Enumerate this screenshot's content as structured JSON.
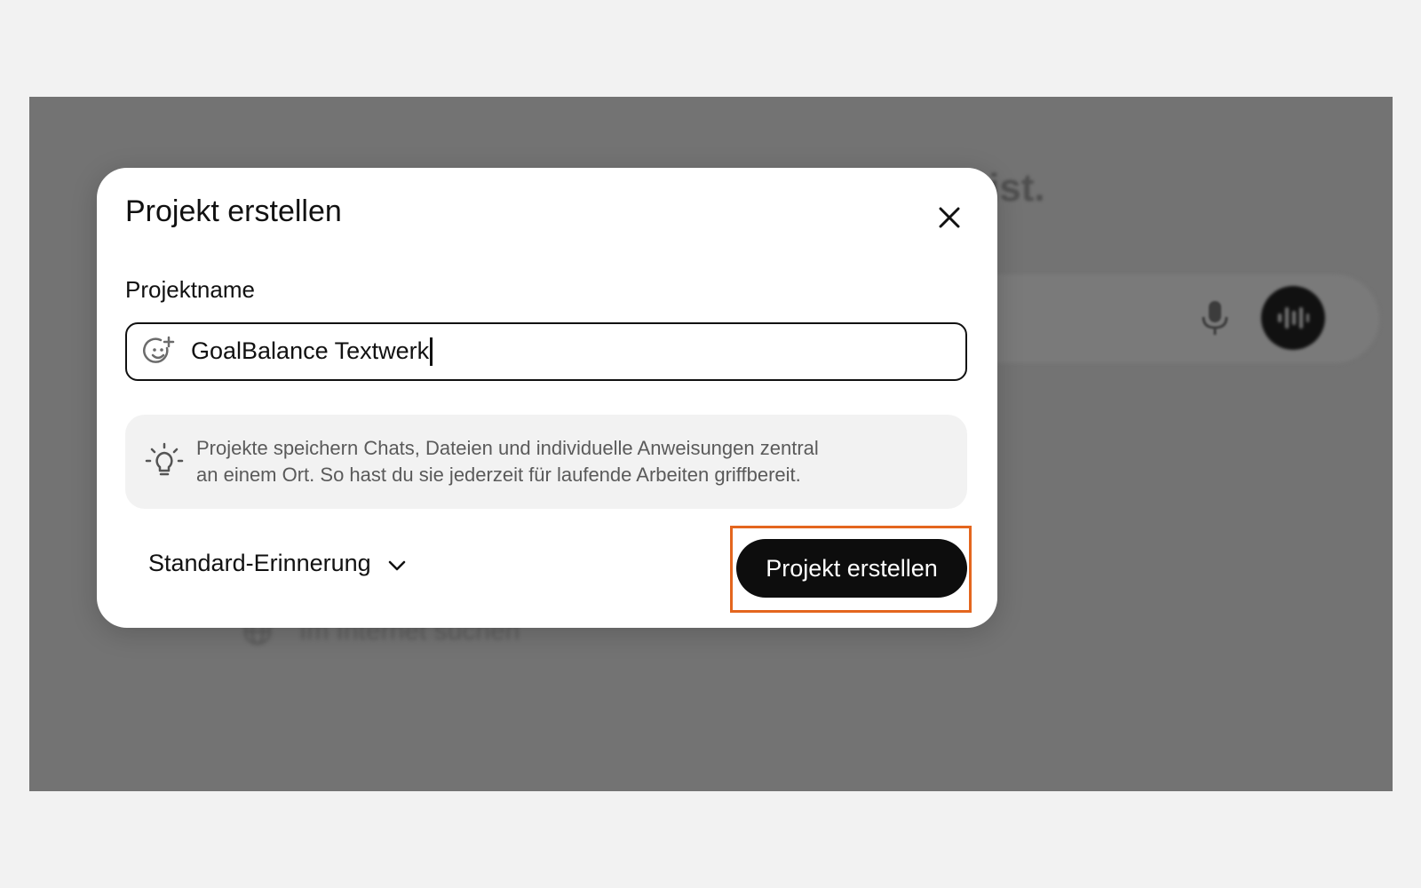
{
  "background": {
    "heading_fragment": "ist.",
    "search_option_label": "Im Internet suchen",
    "icons": [
      "mic-icon",
      "voice-mode-icon",
      "globe-icon"
    ]
  },
  "modal": {
    "title": "Projekt erstellen",
    "close_icon": "close-icon",
    "project_name": {
      "label": "Projektname",
      "value": "GoalBalance Textwerk",
      "icon": "emoji-add-icon"
    },
    "info": {
      "icon": "lightbulb-icon",
      "text_line1": "Projekte speichern Chats, Dateien und individuelle Anweisungen zentral",
      "text_line2": "an einem Ort. So hast du sie jederzeit für laufende Arbeiten griffbereit."
    },
    "reminder": {
      "label": "Standard-Erinnerung",
      "icon": "chevron-down-icon"
    },
    "create_button_label": "Projekt erstellen"
  },
  "colors": {
    "overlay": "#737373",
    "highlight": "#e4661e",
    "primary_button": "#0d0d0d"
  }
}
